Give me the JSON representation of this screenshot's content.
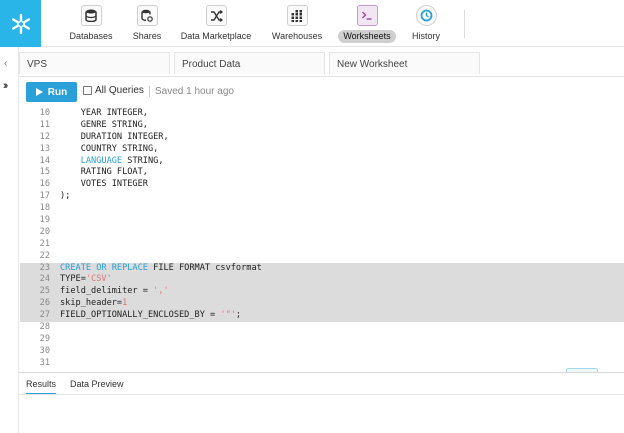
{
  "nav": {
    "items": [
      {
        "label": "Databases",
        "icon": "database-icon"
      },
      {
        "label": "Shares",
        "icon": "share-icon"
      },
      {
        "label": "Data Marketplace",
        "icon": "marketplace-icon"
      },
      {
        "label": "Warehouses",
        "icon": "warehouse-icon"
      },
      {
        "label": "Worksheets",
        "icon": "worksheet-icon",
        "active": true
      },
      {
        "label": "History",
        "icon": "history-icon"
      }
    ]
  },
  "tabs": [
    "VPS",
    "Product Data",
    "New Worksheet"
  ],
  "toolbar": {
    "run_label": "Run",
    "all_queries_label": "All Queries",
    "saved_label": "Saved 1 hour ago"
  },
  "editor": {
    "lines": [
      {
        "n": "10",
        "text": "    YEAR INTEGER,"
      },
      {
        "n": "11",
        "text": "    GENRE STRING,"
      },
      {
        "n": "12",
        "text": "    DURATION INTEGER,"
      },
      {
        "n": "13",
        "text": "    COUNTRY STRING,"
      },
      {
        "n": "14",
        "kw": "LANGUAGE",
        "rest": " STRING,",
        "prefix": "    "
      },
      {
        "n": "15",
        "text": "    RATING FLOAT,"
      },
      {
        "n": "16",
        "text": "    VOTES INTEGER"
      },
      {
        "n": "17",
        "text": ");"
      },
      {
        "n": "18",
        "text": ""
      },
      {
        "n": "19",
        "text": ""
      },
      {
        "n": "20",
        "text": ""
      },
      {
        "n": "21",
        "text": ""
      },
      {
        "n": "22",
        "text": ""
      },
      {
        "n": "23",
        "kw": "CREATE OR REPLACE",
        "rest": " FILE FORMAT csvformat",
        "prefix": "",
        "hl": true
      },
      {
        "n": "24",
        "text": "TYPE=",
        "str": "'CSV'",
        "hl": true
      },
      {
        "n": "25",
        "text": "field_delimiter = ",
        "str": "','",
        "hl": true
      },
      {
        "n": "26",
        "text": "skip_header=",
        "num": "1",
        "hl": true
      },
      {
        "n": "27",
        "text": "FIELD_OPTIONALLY_ENCLOSED_BY = ",
        "str": "'\"'",
        "tail": ";",
        "hl": true
      },
      {
        "n": "28",
        "text": ""
      },
      {
        "n": "29",
        "text": ""
      },
      {
        "n": "30",
        "text": ""
      },
      {
        "n": "31",
        "text": ""
      }
    ]
  },
  "results": {
    "tabs": [
      "Results",
      "Data Preview"
    ]
  },
  "colors": {
    "brand": "#29b5e8",
    "accent": "#29a0d8",
    "keyword": "#29a0d8",
    "string": "#e57373"
  }
}
